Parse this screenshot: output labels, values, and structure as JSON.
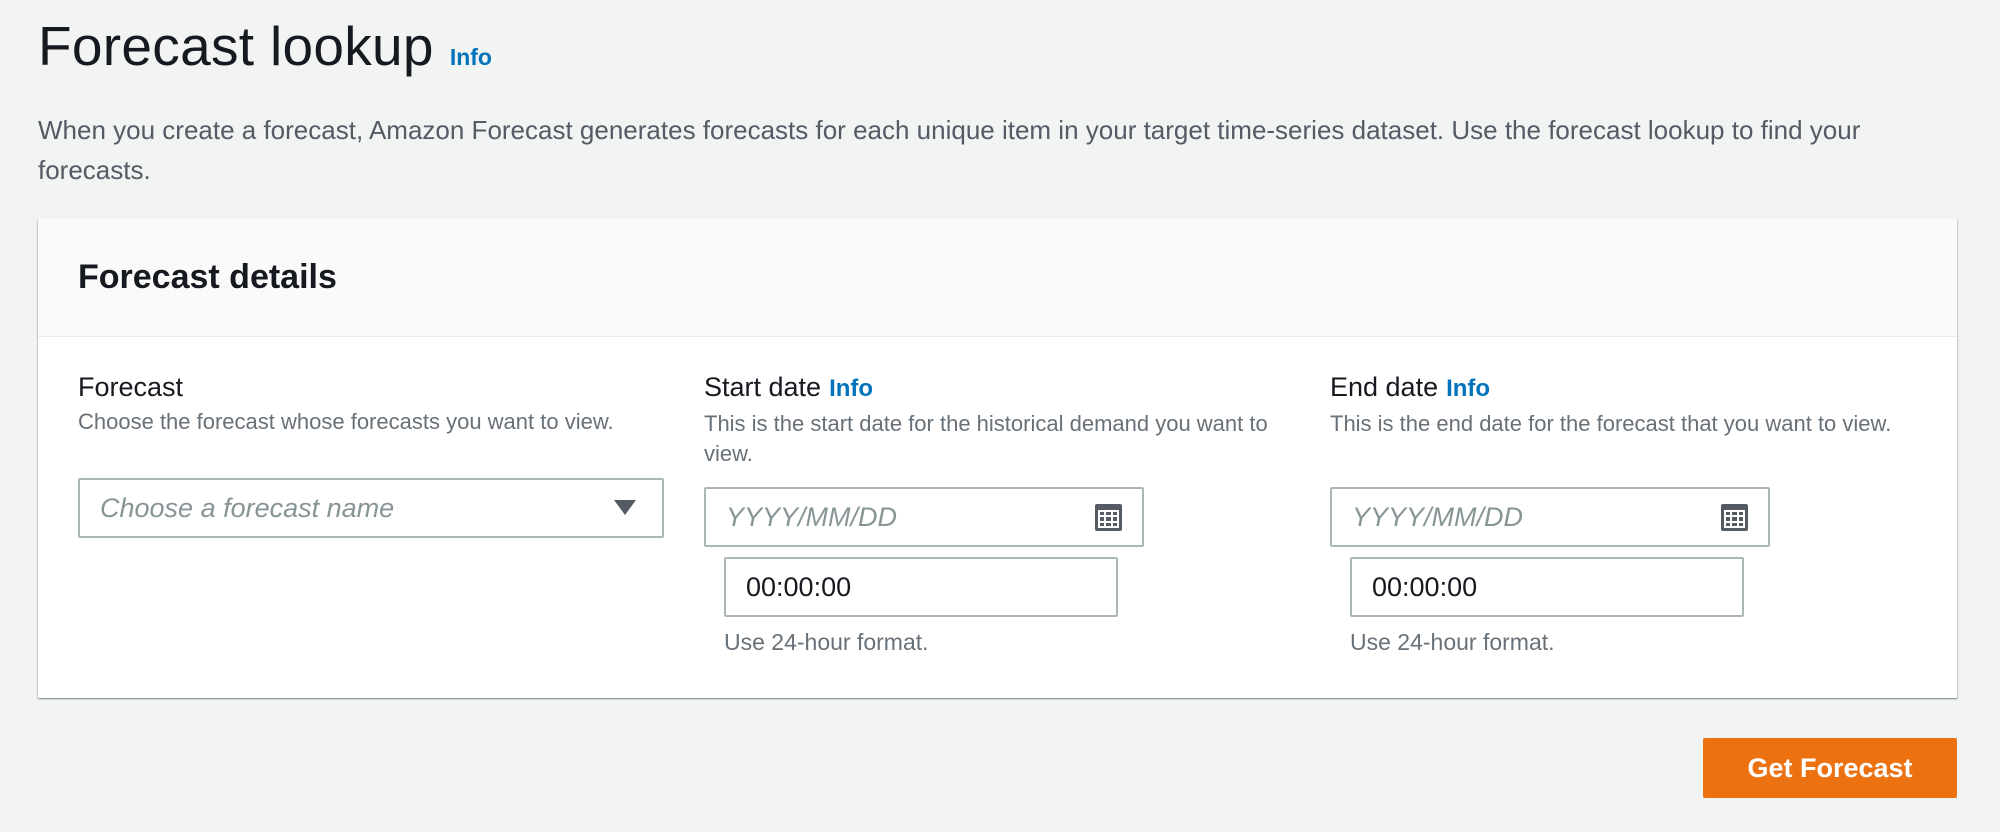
{
  "header": {
    "title": "Forecast lookup",
    "info_label": "Info",
    "description": "When you create a forecast, Amazon Forecast generates forecasts for each unique item in your target time-series dataset. Use the forecast lookup to find your forecasts."
  },
  "card": {
    "title": "Forecast details",
    "forecast": {
      "label": "Forecast",
      "description": "Choose the forecast whose forecasts you want to view.",
      "placeholder": "Choose a forecast name"
    },
    "start_date": {
      "label": "Start date",
      "info_label": "Info",
      "description": "This is the start date for the historical demand you want to view.",
      "date_placeholder": "YYYY/MM/DD",
      "time_value": "00:00:00",
      "hint": "Use 24-hour format."
    },
    "end_date": {
      "label": "End date",
      "info_label": "Info",
      "description": "This is the end date for the forecast that you want to view.",
      "date_placeholder": "YYYY/MM/DD",
      "time_value": "00:00:00",
      "hint": "Use 24-hour format."
    }
  },
  "actions": {
    "primary_label": "Get Forecast"
  },
  "icons": {
    "dropdown": "caret-down-icon",
    "calendar": "calendar-icon"
  },
  "colors": {
    "primary_button": "#ec7211",
    "link": "#0073bb",
    "background": "#f2f3f3"
  }
}
